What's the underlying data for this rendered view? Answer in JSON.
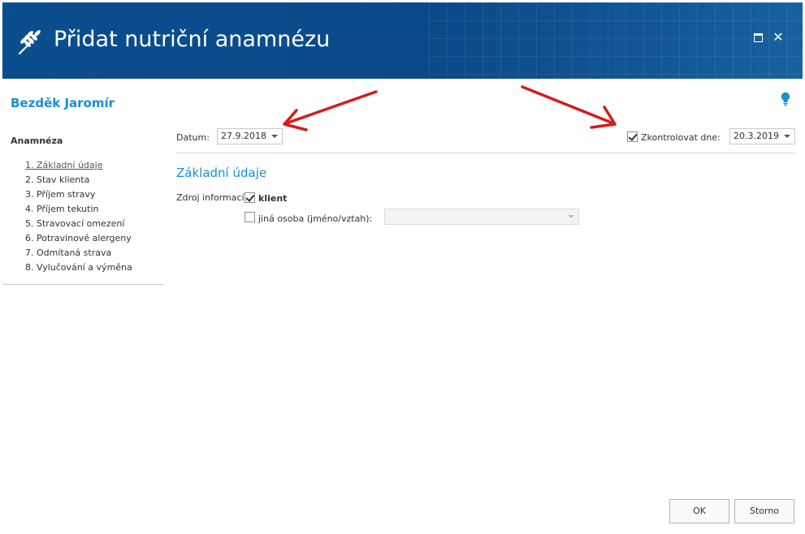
{
  "window": {
    "title": "Přidat nutriční anamnézu",
    "icon": "wheat-icon",
    "maximize_icon": "maximize-icon",
    "close_icon": "close-icon",
    "close_glyph": "✕"
  },
  "client": {
    "name": "Bezděk Jaromír"
  },
  "sidebar": {
    "heading": "Anamnéza",
    "items": [
      {
        "label": "1. Základní údaje",
        "active": true
      },
      {
        "label": "2. Stav klienta"
      },
      {
        "label": "3. Příjem stravy"
      },
      {
        "label": "4. Příjem tekutin"
      },
      {
        "label": "5. Stravovací omezení"
      },
      {
        "label": "6. Potravinové alergeny"
      },
      {
        "label": "7. Odmítaná strava"
      },
      {
        "label": "8. Vylučování a výměna"
      }
    ]
  },
  "form": {
    "date_label": "Datum:",
    "date_value": "27.9.2018",
    "check_label": "Zkontrolovat dne:",
    "check_checked": true,
    "check_date_value": "20.3.2019",
    "section_title": "Základní údaje",
    "source_label": "Zdroj informací:",
    "source_client_label": "klient",
    "source_client_checked": true,
    "source_other_label": "jiná osoba (jméno/vztah):",
    "source_other_checked": false,
    "source_other_value": ""
  },
  "buttons": {
    "ok": "OK",
    "cancel": "Storno"
  },
  "colors": {
    "title_bar": "#0b4e8e",
    "accent": "#1a8fd1",
    "annotation_arrow": "#d41c1c"
  }
}
